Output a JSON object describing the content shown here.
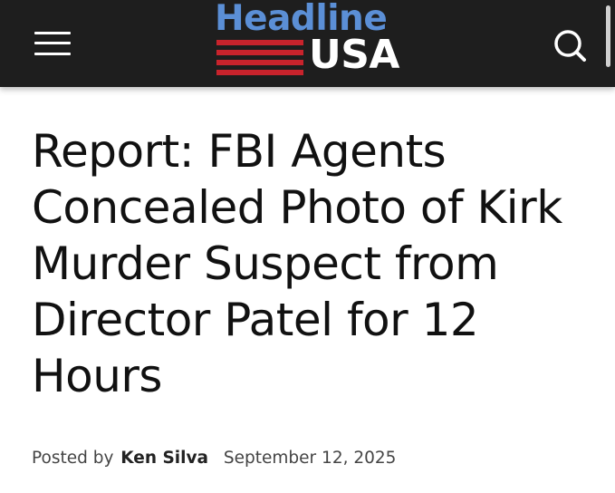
{
  "header": {
    "logo_top": "Headline",
    "logo_bottom": "USA",
    "menu_icon": "hamburger-menu-icon",
    "search_icon": "search-icon"
  },
  "article": {
    "title": "Report: FBI Agents Concealed Photo of Kirk Murder Suspect from Director Patel for 12 Hours",
    "posted_by_label": "Posted by",
    "author": "Ken Silva",
    "date": "September 12, 2025"
  },
  "colors": {
    "header_bg": "#1e1e1e",
    "logo_blue": "#5b8fd6",
    "logo_red": "#c8232c",
    "headline_text": "#111111"
  }
}
